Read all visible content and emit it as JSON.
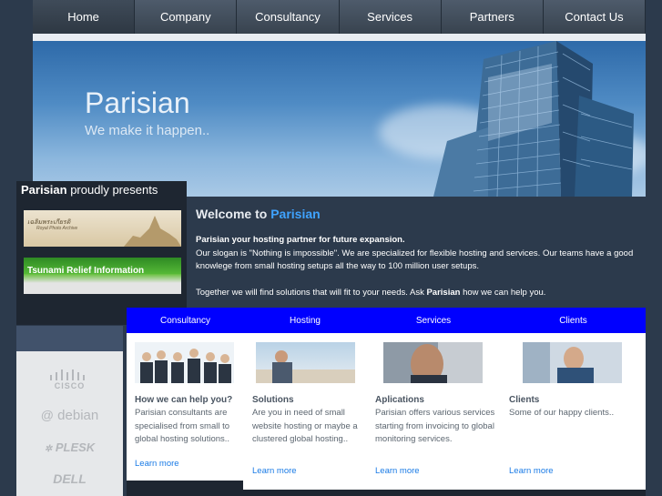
{
  "nav": {
    "items": [
      "Home",
      "Company",
      "Consultancy",
      "Services",
      "Partners",
      "Contact Us"
    ]
  },
  "hero": {
    "title": "Parisian",
    "subtitle": "We make it happen.."
  },
  "sidebar": {
    "brand": "Parisian",
    "presents": " proudly presents",
    "banner1_text": "เฉลิมพระเกียรติ",
    "banner1_sub": "Royal Photo Archive",
    "banner2_text": "Tsunami Relief Information"
  },
  "partners": {
    "logos": [
      "CISCO",
      "debian",
      "PLESK",
      "DELL"
    ]
  },
  "welcome": {
    "heading_prefix": "Welcome to ",
    "heading_brand": "Parisian",
    "lead": "Parisian your hosting partner for future expansion.",
    "body": "Our slogan is \"Nothing is impossible\". We are specialized for flexible hosting and services. Our teams have a good knowlege from small hosting setups all the way to 100 million user setups.",
    "p2_prefix": "Together we will find solutions that will fit to your needs. Ask ",
    "p2_brand": "Parisian",
    "p2_suffix": " how we can help you."
  },
  "tabs": [
    "Consultancy",
    "Hosting",
    "Services",
    "Clients"
  ],
  "columns": [
    {
      "heading": "How we can help you?",
      "text": "Parisian consultants are specialised from small to global hosting solutions..",
      "link": "Learn more"
    },
    {
      "heading": "Solutions",
      "text": "Are you in need of small website hosting or maybe a clustered global hosting..",
      "link": "Learn more"
    },
    {
      "heading": "Aplications",
      "text": "Parisian offers various services starting from invoicing to global monitoring services.",
      "link": "Learn more"
    },
    {
      "heading": "Clients",
      "text": "Some of our happy clients..",
      "link": "Learn more"
    }
  ],
  "colors": {
    "accent": "#3fa3ff",
    "tab_bar": "#0000ff",
    "link": "#1a7be6",
    "background": "#2c3a4c"
  }
}
